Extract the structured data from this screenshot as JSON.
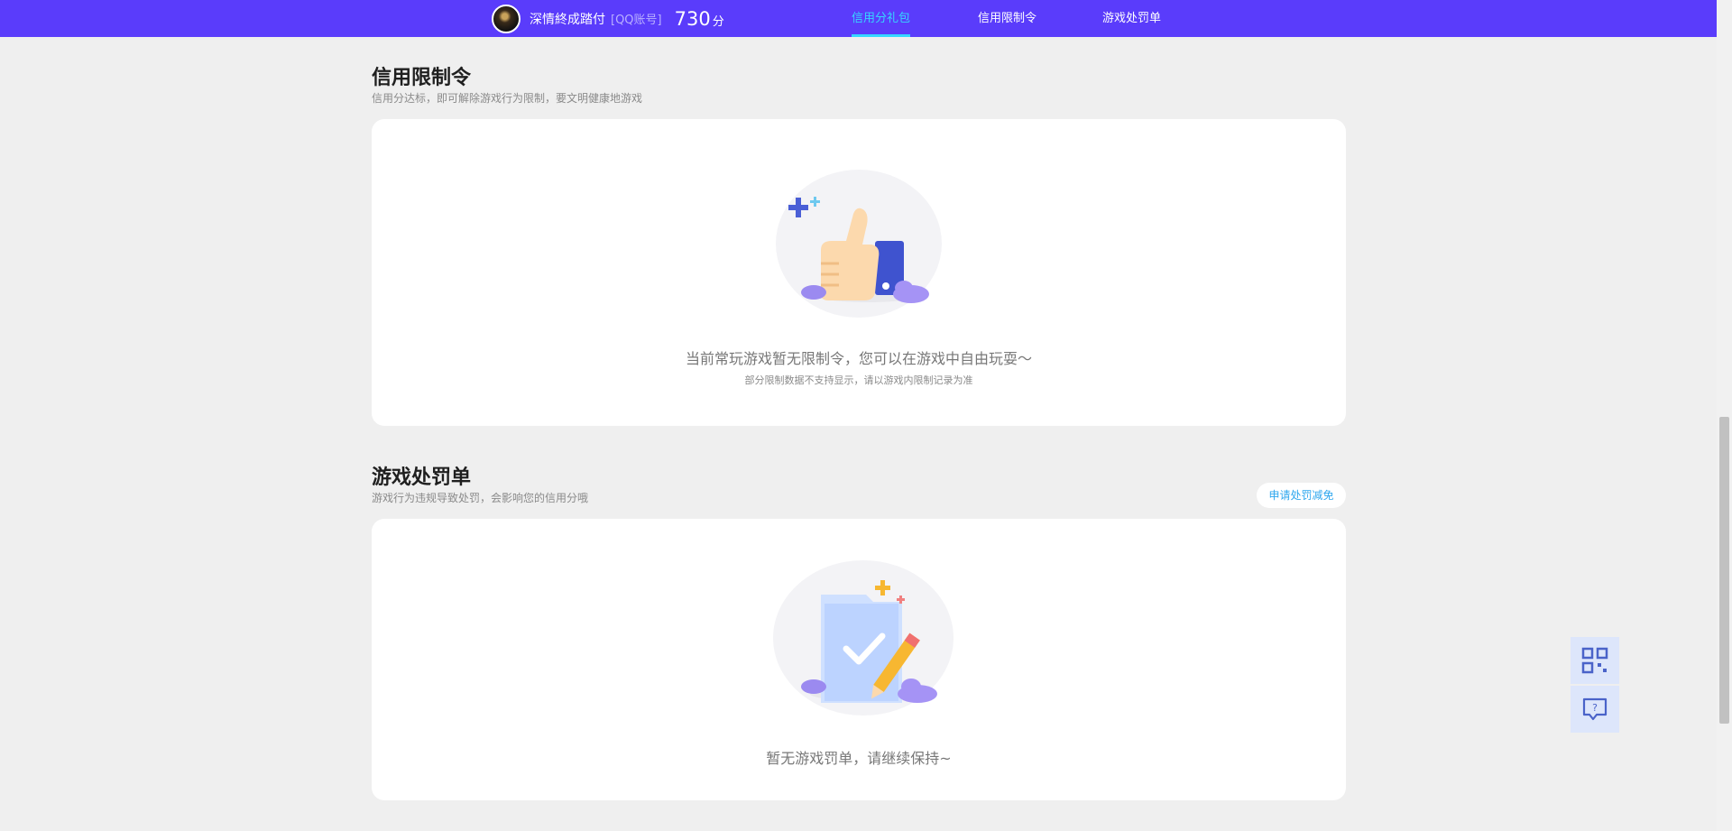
{
  "header": {
    "user_name": "深情終成踏付",
    "account_type": "[QQ账号]",
    "score": "730",
    "score_unit": "分",
    "tabs": [
      {
        "label": "信用分礼包",
        "active": true
      },
      {
        "label": "信用限制令",
        "active": false
      },
      {
        "label": "游戏处罚单",
        "active": false
      }
    ]
  },
  "restriction": {
    "title": "信用限制令",
    "subtitle": "信用分达标，即可解除游戏行为限制，要文明健康地游戏",
    "empty_message": "当前常玩游戏暂无限制令，您可以在游戏中自由玩耍～",
    "note": "部分限制数据不支持显示，请以游戏内限制记录为准"
  },
  "penalty": {
    "title": "游戏处罚单",
    "subtitle": "游戏行为违规导致处罚，会影响您的信用分哦",
    "apply_button": "申请处罚减免",
    "empty_message": "暂无游戏罚单，请继续保持~"
  },
  "colors": {
    "header_bg": "#5a3cfb",
    "active_tab": "#35d7ff",
    "link": "#2fa7ee",
    "page_bg": "#efefef"
  },
  "icons": [
    "qr-code-icon",
    "feedback-icon"
  ]
}
